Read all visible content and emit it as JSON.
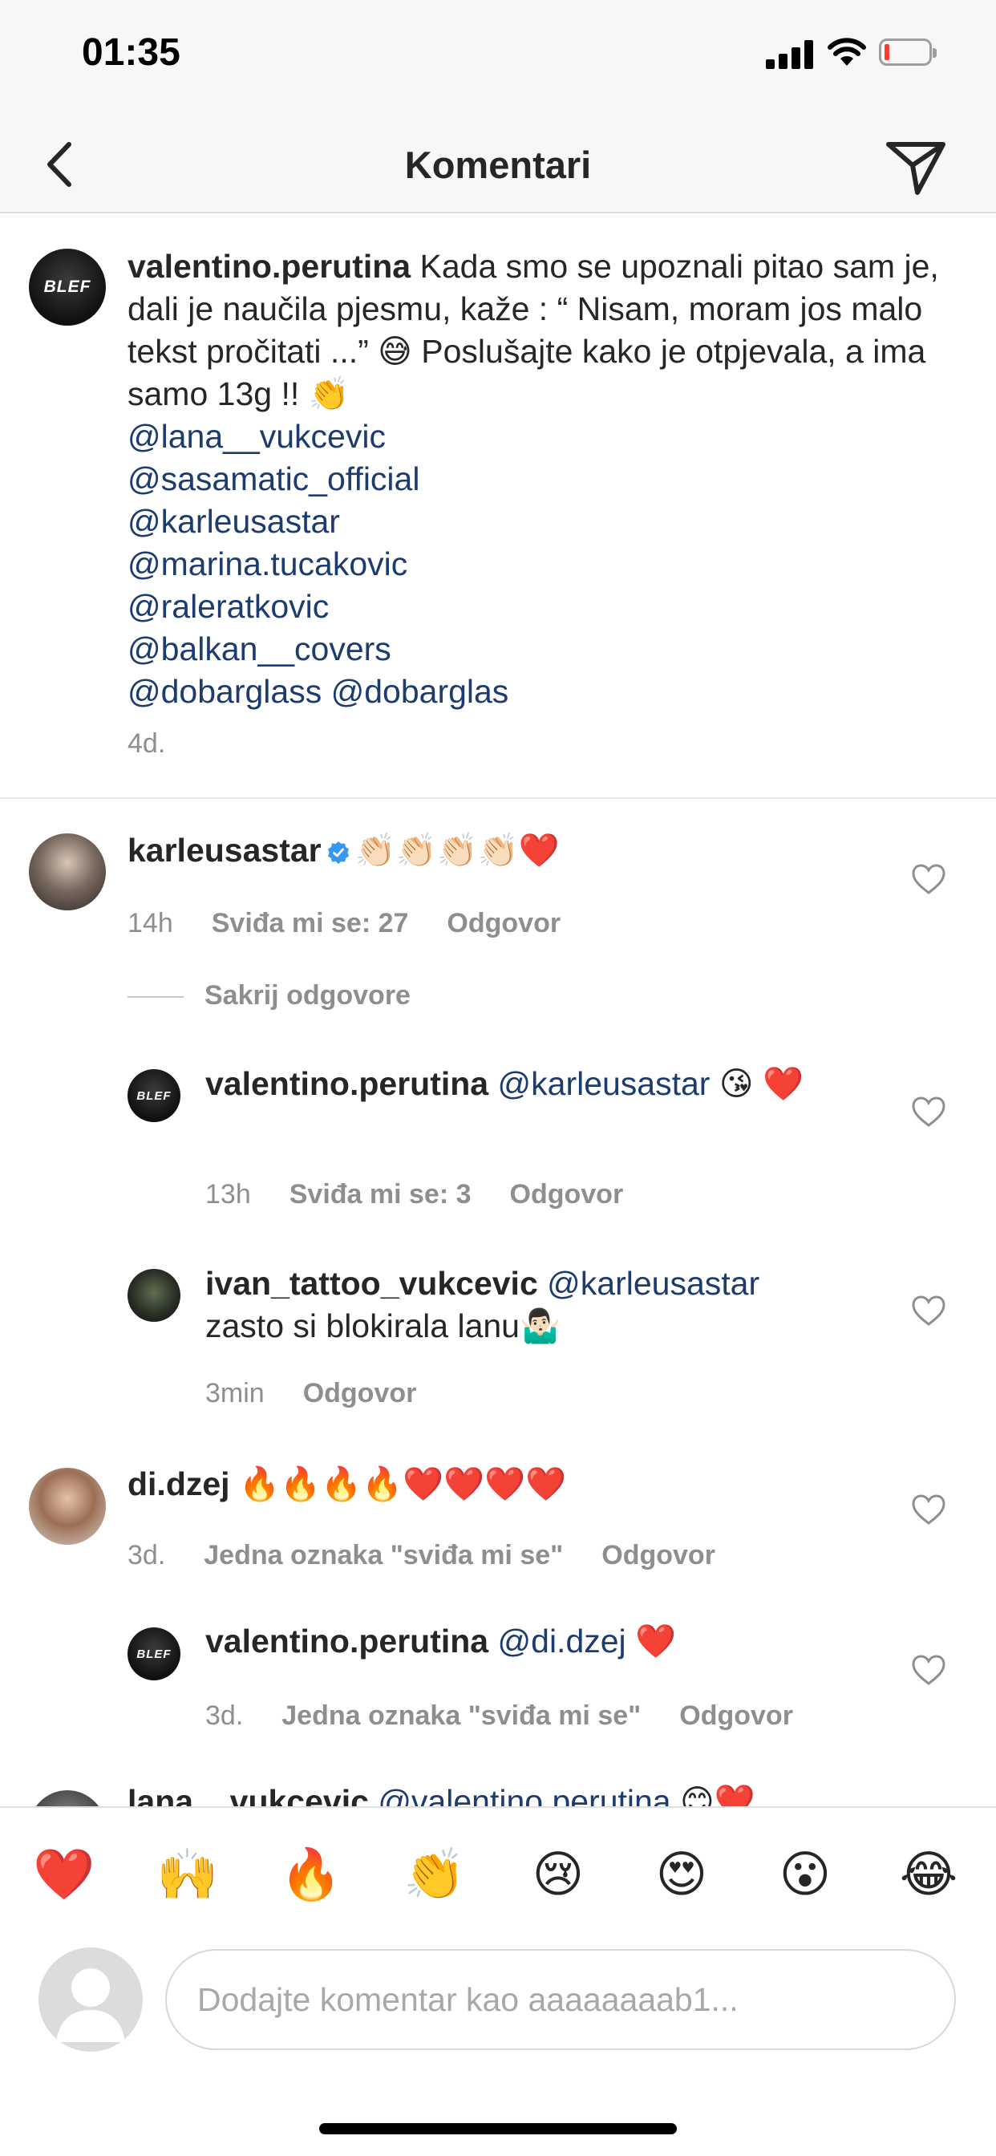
{
  "status": {
    "time": "01:35"
  },
  "nav": {
    "title": "Komentari"
  },
  "caption": {
    "username": "valentino.perutina",
    "text": "Kada smo se upoznali pitao sam je, dali je naučila pjesmu, kaže : “ Nisam, moram jos malo tekst pročitati ...” 😅 Poslušajte kako je otpjevala, a ima samo 13g !! 👏",
    "mentions": [
      "@lana__vukcevic",
      "@sasamatic_official",
      "@karleusastar",
      "@marina.tucakovic",
      "@raleratkovic",
      "@balkan__covers"
    ],
    "last_line_a": "@dobarglass",
    "last_line_b": "@dobarglas",
    "time": "4d.",
    "avatar_text": "BLEF"
  },
  "comments": [
    {
      "username": "karleusastar",
      "text": "👏🏻👏🏻👏🏻👏🏻❤️",
      "time": "14h",
      "likes": "Sviđa mi se: 27",
      "reply": "Odgovor",
      "verified": true
    },
    {
      "hide_replies": "Sakrij odgovore"
    },
    {
      "username": "valentino.perutina",
      "mention": "@karleusastar",
      "text": "😘 ❤️",
      "time": "13h",
      "likes": "Sviđa mi se: 3",
      "reply": "Odgovor",
      "avatar_text": "BLEF"
    },
    {
      "username": "ivan_tattoo_vukcevic",
      "mention": "@karleusastar",
      "text": "zasto si blokirala lanu🤷🏻‍♂️",
      "time": "3min",
      "reply": "Odgovor"
    },
    {
      "username": "di.dzej",
      "text": "🔥🔥🔥🔥❤️❤️❤️❤️",
      "time": "3d.",
      "likes": "Jedna oznaka \"sviđa mi se\"",
      "reply": "Odgovor"
    },
    {
      "username": "valentino.perutina",
      "mention": "@di.dzej",
      "text": "❤️",
      "time": "3d.",
      "likes": "Jedna oznaka \"sviđa mi se\"",
      "reply": "Odgovor",
      "avatar_text": "BLEF"
    },
    {
      "username": "lana__vukcevic",
      "mention": "@valentino.perutina",
      "text": "😊❤️"
    }
  ],
  "emoji_bar": [
    "❤️",
    "🙌",
    "🔥",
    "👏",
    "😢",
    "😍",
    "😮",
    "😂"
  ],
  "input": {
    "placeholder": "Dodajte komentar kao aaaaaaaab1..."
  },
  "colors": {
    "mention": "#1c3b6e",
    "meta": "#8e8e8e",
    "verified": "#3897f0"
  }
}
